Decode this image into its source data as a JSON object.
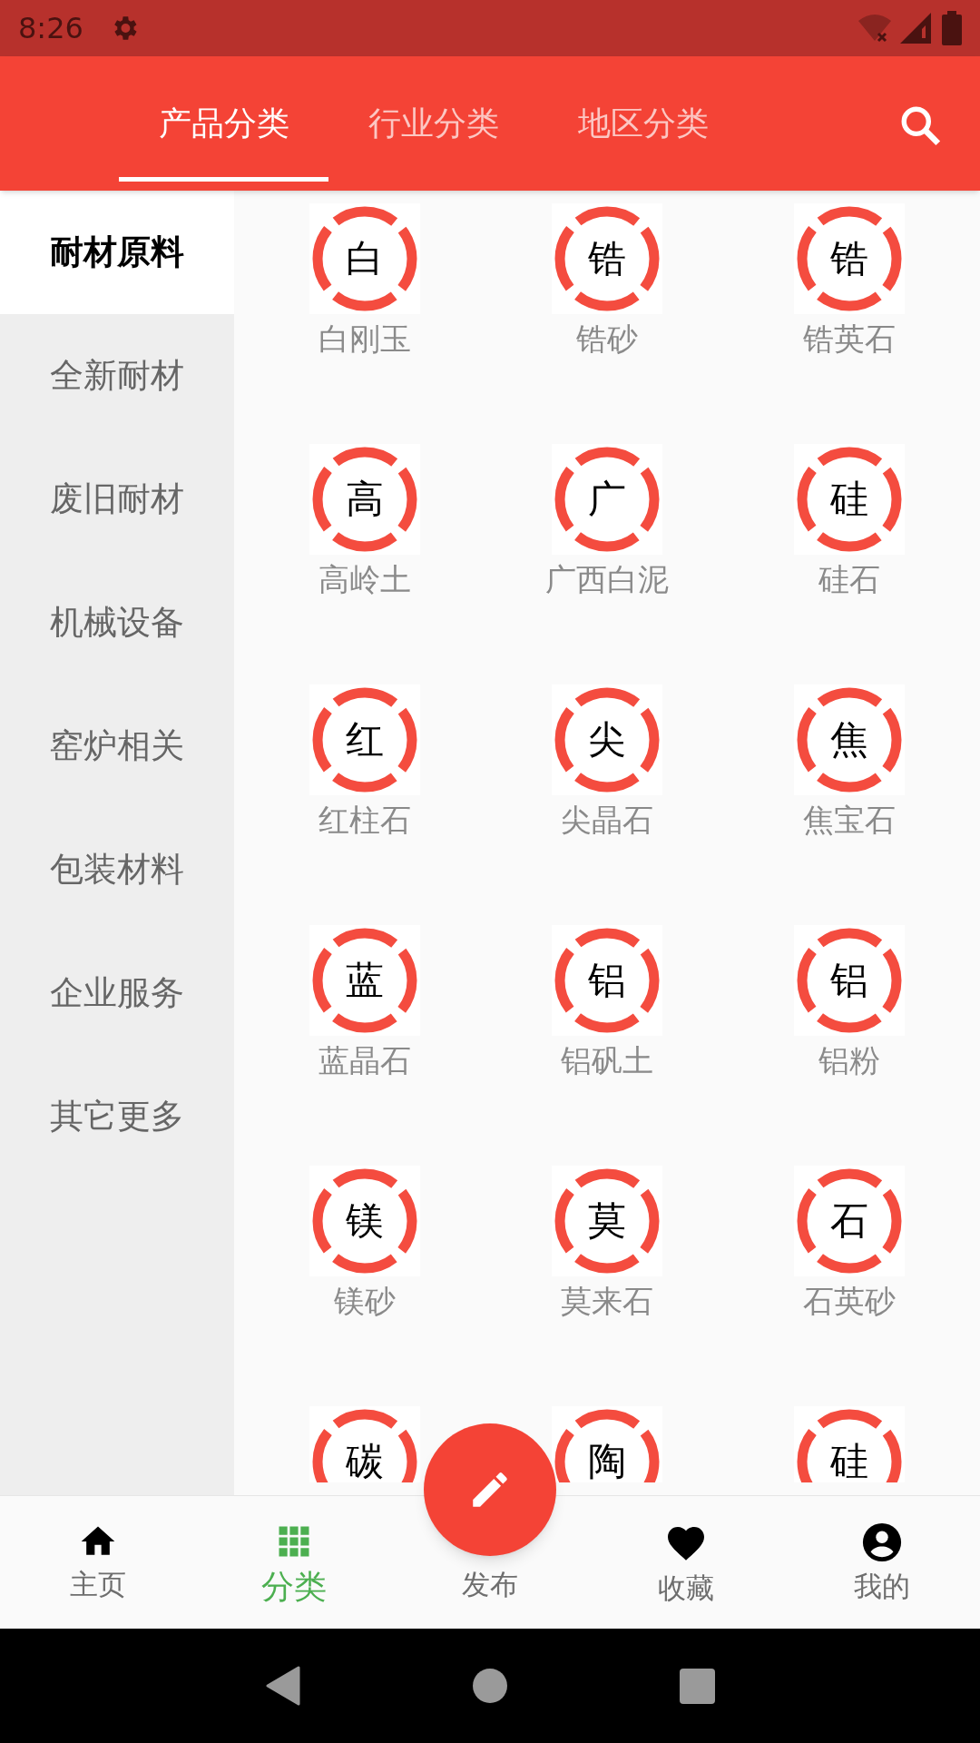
{
  "status_bar": {
    "time": "8:26"
  },
  "tabs": [
    {
      "label": "产品分类",
      "selected": true
    },
    {
      "label": "行业分类",
      "selected": false
    },
    {
      "label": "地区分类",
      "selected": false
    }
  ],
  "sidebar": {
    "items": [
      {
        "label": "耐材原料",
        "selected": true
      },
      {
        "label": "全新耐材",
        "selected": false
      },
      {
        "label": "废旧耐材",
        "selected": false
      },
      {
        "label": "机械设备",
        "selected": false
      },
      {
        "label": "窑炉相关",
        "selected": false
      },
      {
        "label": "包装材料",
        "selected": false
      },
      {
        "label": "企业服务",
        "selected": false
      },
      {
        "label": "其它更多",
        "selected": false
      }
    ]
  },
  "categories": [
    {
      "char": "白",
      "label": "白刚玉"
    },
    {
      "char": "锆",
      "label": "锆砂"
    },
    {
      "char": "锆",
      "label": "锆英石"
    },
    {
      "char": "高",
      "label": "高岭土"
    },
    {
      "char": "广",
      "label": "广西白泥"
    },
    {
      "char": "硅",
      "label": "硅石"
    },
    {
      "char": "红",
      "label": "红柱石"
    },
    {
      "char": "尖",
      "label": "尖晶石"
    },
    {
      "char": "焦",
      "label": "焦宝石"
    },
    {
      "char": "蓝",
      "label": "蓝晶石"
    },
    {
      "char": "铝",
      "label": "铝矾土"
    },
    {
      "char": "铝",
      "label": "铝粉"
    },
    {
      "char": "镁",
      "label": "镁砂"
    },
    {
      "char": "莫",
      "label": "莫来石"
    },
    {
      "char": "石",
      "label": "石英砂"
    },
    {
      "char": "碳"
    },
    {
      "char": "陶"
    },
    {
      "char": "硅"
    }
  ],
  "bottom_nav": [
    {
      "label": "主页",
      "selected": false
    },
    {
      "label": "分类",
      "selected": true
    },
    {
      "label": "发布",
      "selected": false
    },
    {
      "label": "收藏",
      "selected": false
    },
    {
      "label": "我的",
      "selected": false
    }
  ]
}
